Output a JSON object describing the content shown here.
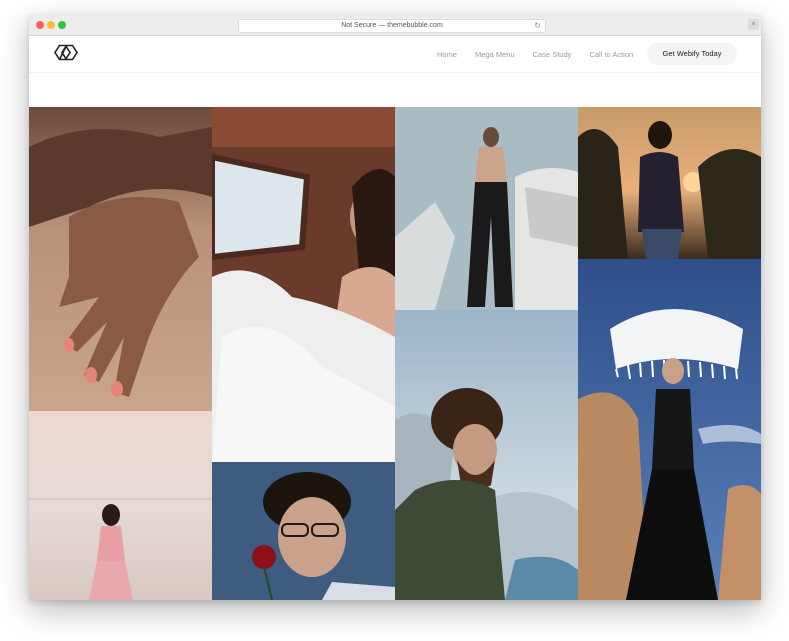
{
  "browser": {
    "address": "Not Secure — themebubble.com",
    "reload_icon": "reload-icon",
    "window_control_icon": "close-icon"
  },
  "site": {
    "logo_icon": "logo-icon",
    "nav": [
      {
        "label": "Home"
      },
      {
        "label": "Mega Menu"
      },
      {
        "label": "Case Study"
      },
      {
        "label": "Call to Action"
      }
    ],
    "cta_label": "Get Webify Today"
  },
  "gallery": {
    "images": [
      {
        "name": "hand-on-sand-photo"
      },
      {
        "name": "bride-white-dress-photo"
      },
      {
        "name": "woman-concrete-structure-photo"
      },
      {
        "name": "woman-sunset-photo"
      },
      {
        "name": "woman-umbrella-hat-photo"
      },
      {
        "name": "woman-beach-pink-dress-photo"
      },
      {
        "name": "man-red-rose-photo"
      },
      {
        "name": "man-beard-rocks-photo"
      }
    ]
  },
  "colors": {
    "traffic_red": "#ff5f57",
    "traffic_yellow": "#febc2e",
    "traffic_green": "#28c840",
    "nav_text": "#9b9b9b",
    "cta_bg": "#f4f4f4"
  }
}
